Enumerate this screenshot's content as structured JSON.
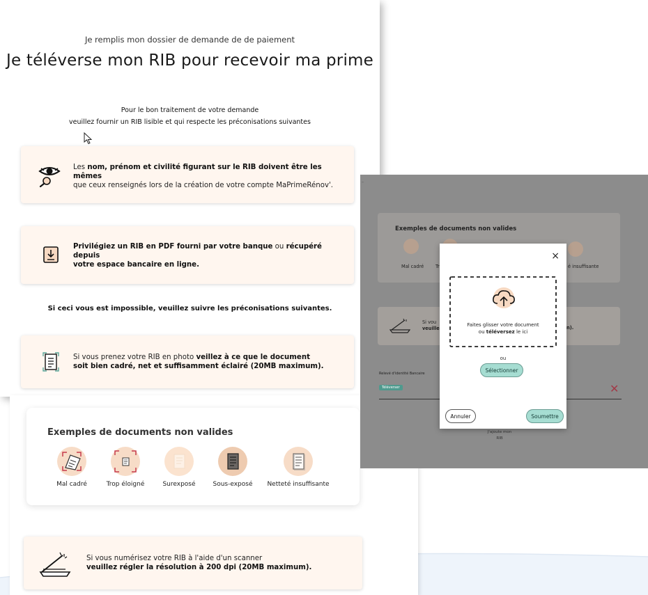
{
  "page": {
    "subtitle": "Je remplis mon dossier de demande de de paiement",
    "title": "Je téléverse mon RIB pour recevoir ma prime",
    "intro_line1": "Pour le bon traitement de votre demande",
    "intro_line2": "veuillez fournir un RIB lisible et qui respecte les préconisations suivantes"
  },
  "cards": {
    "card1": {
      "icon": "eye-magnifier-icon",
      "pre": "Les ",
      "bold": "nom, prénom et civilité figurant sur le RIB doivent être les mêmes",
      "post": "que ceux renseignés lors de la création de votre compte MaPrimeRénov'."
    },
    "card2": {
      "icon": "pdf-download-icon",
      "bold1": "Privilégiez un RIB en PDF fourni par votre banque",
      "mid": " ou ",
      "bold2": "récupéré depuis",
      "bold3": "votre espace bancaire en ligne."
    },
    "middle_note": "Si ceci vous est impossible, veuillez suivre les préconisations suivantes.",
    "card3": {
      "icon": "framed-document-icon",
      "pre": "Si vous prenez votre RIB en photo ",
      "bold1": "veillez à ce que le document",
      "bold2": "soit bien cadré, net et suffisamment éclairé (20MB maximum)."
    },
    "card4": {
      "icon": "scanner-icon",
      "line1": "Si vous numérisez votre RIB à l'aide d'un scanner",
      "bold": "veuillez régler la résolution à 200 dpi (20MB maximum)."
    }
  },
  "examples": {
    "title": "Exemples de documents non valides",
    "items": [
      {
        "label": "Mal cadré",
        "icon": "badly-framed-icon"
      },
      {
        "label": "Trop éloigné",
        "icon": "too-far-icon"
      },
      {
        "label": "Surexposé",
        "icon": "overexposed-icon"
      },
      {
        "label": "Sous-exposé",
        "icon": "underexposed-icon"
      },
      {
        "label": "Netteté insuffisante",
        "icon": "blurry-icon"
      }
    ]
  },
  "overlay": {
    "bg_title": "Exemples de documents non valides",
    "bg_label1": "Mal cadré",
    "bg_label2": "Tr",
    "bg_label3": "é insuffisante",
    "bg_card_line1": "Si vou",
    "bg_card_line2": "veuille",
    "bg_card_end": "n).",
    "field_label": "Relevé d'identité Bancaire",
    "upload_tag": "Téléverser",
    "bottom_label_1": "J'ajoute mon",
    "bottom_label_2": "RIB",
    "modal": {
      "close": "×",
      "drop_line1": "Faites glisser votre document",
      "drop_line2_pre": "ou ",
      "drop_line2_bold": "téléversez",
      "drop_line2_post": " le ici",
      "or_text": "ou",
      "select_button": "Sélectionner",
      "cancel_button": "Annuler",
      "submit_button": "Soumettre"
    }
  },
  "colors": {
    "card_bg": "#fff6ef",
    "accent_peach": "#f7d9c2",
    "button_teal": "#a6ddd2",
    "remove_red": "#c63a4b"
  }
}
